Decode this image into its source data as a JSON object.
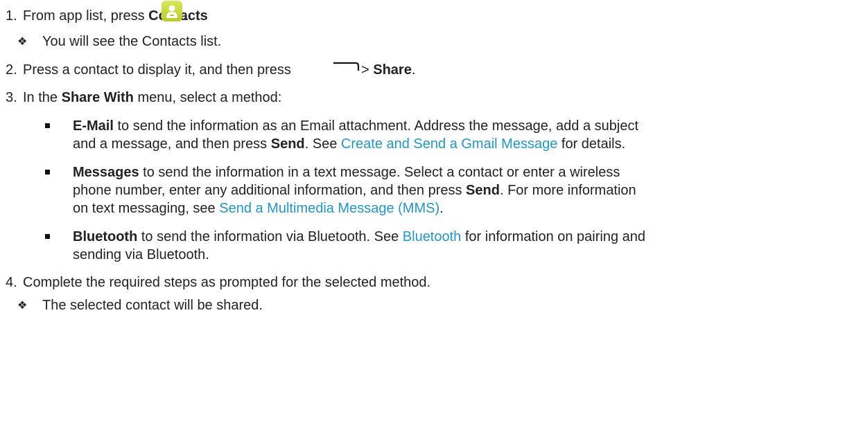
{
  "steps": [
    {
      "num": "1.",
      "pre": "From app list, press ",
      "bold": "Contacts",
      "post": "."
    },
    {
      "num": "2.",
      "pre": "Press a contact to display it, and then press",
      "mid": " > ",
      "bold": "Share",
      "post": "."
    },
    {
      "num": "3.",
      "pre": "In the ",
      "bold": "Share With",
      "post": " menu, select a method:"
    },
    {
      "num": "4.",
      "text": "Complete the required steps as prompted for the selected method."
    }
  ],
  "notes": {
    "contacts_list": "You will see the Contacts list.",
    "shared": "The selected contact will be shared."
  },
  "methods": {
    "email": {
      "bold": "E-Mail",
      "l1": " to send the information as an Email attachment. Address the message, add a subject",
      "l2a": "and a message, and then press ",
      "send": "Send",
      "l2b": ". See ",
      "link": "Create and Send a Gmail Message",
      "l2c": " for details."
    },
    "messages": {
      "bold": "Messages",
      "l1": " to send the information in a text message. Select a contact or enter a wireless",
      "l2a": "phone number, enter any additional information, and then press ",
      "send": "Send",
      "l2b": ". For more information",
      "l3a": "on text messaging, see ",
      "link": "Send a Multimedia Message (MMS)",
      "l3b": "."
    },
    "bluetooth": {
      "bold": "Bluetooth",
      "l1a": " to send the information via Bluetooth. See ",
      "link": "Bluetooth",
      "l1b": " for information on pairing and",
      "l2": "sending via Bluetooth."
    }
  },
  "icons": {
    "app": "contacts-app-icon",
    "menu": "menu-key-icon",
    "diamond": "four-diamond-bullet-icon",
    "square": "square-bullet-icon"
  },
  "colors": {
    "link": "#1f97c9",
    "contacts_icon": "#c6d837"
  }
}
